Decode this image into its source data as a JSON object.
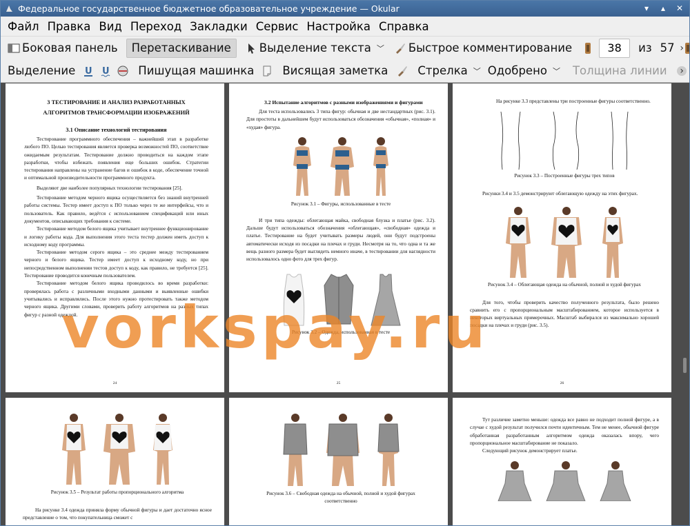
{
  "window": {
    "title": "Федеральное государственное бюджетное образовательное учреждение  — Okular"
  },
  "menu": [
    "Файл",
    "Правка",
    "Вид",
    "Переход",
    "Закладки",
    "Сервис",
    "Настройка",
    "Справка"
  ],
  "toolbar1": {
    "sidebar": "Боковая панель",
    "drag": "Перетаскивание",
    "text_select": "Выделение текста",
    "quick_comment": "Быстрое комментирование",
    "page_value": "38",
    "of": "из",
    "total": "57"
  },
  "toolbar2": {
    "selection": "Выделение",
    "typewriter": "Пишущая машинка",
    "sticky_note": "Висящая заметка",
    "arrow": "Стрелка",
    "approved": "Одобрено",
    "line_width": "Толщина линии"
  },
  "watermark": "vorkspay.ru",
  "pages": {
    "p1": {
      "heading1": "3  ТЕСТИРОВАНИЕ И АНАЛИЗ РАЗРАБОТАННЫХ",
      "heading2": "АЛГОРИТМОВ ТРАНСФОРМАЦИИ ИЗОБРАЖЕНИЙ",
      "sub": "3.1    Описание технологий тестирования",
      "paras": [
        "Тестирование программного обеспечения – важнейший этап в разработке любого ПО. Целью тестирования является проверка возможностей ПО, соответствие ожидаемым результатам. Тестирование должно проводиться на каждом этапе разработки, чтобы избежать появления еще больших ошибок. Стратегии тестирования направлены на устранение багов и ошибок в коде, обеспечение точной и оптимальной производительности программного продукта.",
        "Выделяют две наиболее популярных технологии тестирования [25].",
        "Тестирование методом черного ящика осуществляется без знаний внутренней работы системы. Тестер имеет доступ к ПО только через те же интерфейсы, что и пользователь. Как правило, ведётся с использованием спецификаций или иных документов, описывающих требования к системе.",
        "Тестирование методом белого ящика учитывает внутреннее функционирование и логику работы кода. Для выполнения этого теста тестер должен иметь доступ к исходному коду программы.",
        "Тестирование методом серого ящика – это среднее между тестированием черного и белого ящика. Тестер имеет доступ к исходному коду, но при непосредственном выполнении тестов доступ к коду, как правило, не требуется [25]. Тестирование проводится конечным пользователем.",
        "Тестирование методом белого ящика проводилось во время разработки: проверялась работа с различными входными данными и выявленные ошибки учитывались и исправлялись. После этого нужно протестировать также методом черного ящика. Другими словами, проверить работу алгоритмов на разных типах фигур с разной одеждой."
      ],
      "num": "24"
    },
    "p2": {
      "sub": "3.2     Испытание алгоритмов с разными изображениями и фигурами",
      "para1": "Для теста использовались 3 типа фигур: обычная и две нестандартных (рис. 3.1). Для простоты в дальнейшем будут использоваться обозначения «обычная», «полная» и «худая» фигура.",
      "cap1": "Рисунок 3.1 – Фигуры, использованные в тесте",
      "para2": "И три типа одежды: облегающая майка, свободная блузка и платье (рис. 3.2). Дальше будут использоваться обозначения «облегающая», «свободная» одежда и платье. Тестирование на будет учитывать размеры людей, они будут подстроены автоматически исходя из посадки на плечах и груди. Несмотря на то, что одна и та же вещь разного размера будет выглядеть немного иначе, в тестировании для наглядности использовалось одно фото для трех фигур.",
      "cap2": "Рисунок 3.2 – Одежда, использованная в тесте",
      "num": "25"
    },
    "p3": {
      "para1": "На рисунке 3.3 представлены три построенные фигуры соответственно.",
      "cap1": "Рисунок 3.3 – Построенные фигуры трех типов",
      "para2": "Рисунки 3.4 и 3.5 демонстрируют облегающую одежду на этих фигурах.",
      "cap2": "Рисунок 3.4 – Облегающая одежда на обычной, полной и худой фигурах",
      "para3": "Для того, чтобы проверить качество полученного результата, было решено сравнить его с пропорциональным масштабированием, которое используется в некоторых виртуальных примерочных. Масштаб выбирался из максимально хорошей посадки на плечах и груди (рис. 3.5).",
      "num": "26"
    },
    "p4": {
      "cap1": "Рисунок 3.5 – Результат работы пропорционального алгоритма",
      "para1": "На рисунке 3.4 одежда приняла форму обычной фигуры и дает достаточно ясное представление о том, что покупательница сможет с"
    },
    "p5": {
      "cap1": "Рисунок 3.6 – Свободная одежда на обычной, полной и худой фигурах",
      "cap1b": "соответственно"
    },
    "p6": {
      "para1": "Тут различие заметно меньше: одежда все равно не подходит полной фигуре, а в случае с худой результат получился почти идентичным. Тем не менее, обычной фигуре обработанная разработанным алгоритмом одежда оказалась впору, чего пропорциональное масштабирование не показало.",
      "para2": "Следующий рисунок демонстрирует платье."
    }
  },
  "colors": {
    "titlebar": "#3f6b9b",
    "toolbar": "#efefef",
    "viewer": "#4c4c4c",
    "watermark": "#ec8628"
  }
}
